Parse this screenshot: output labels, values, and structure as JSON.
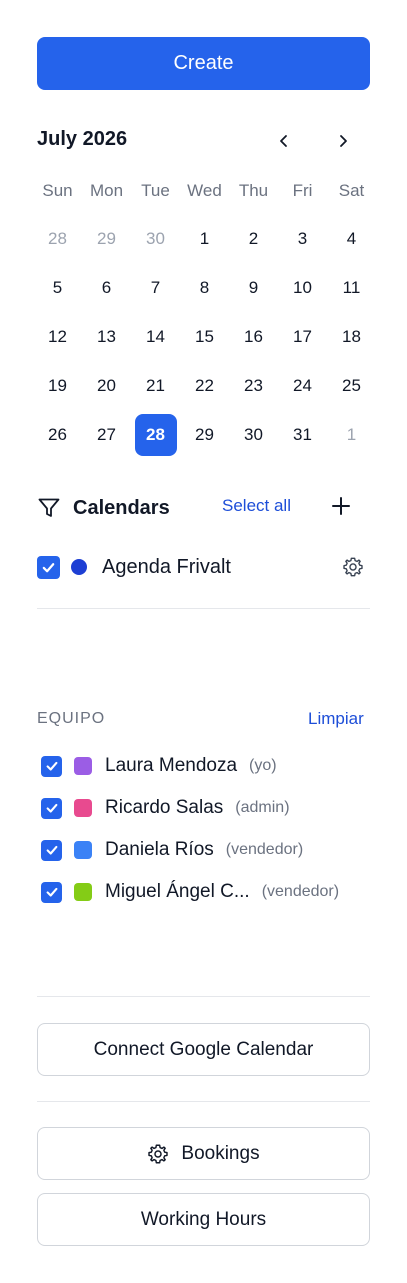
{
  "create": {
    "label": "Create"
  },
  "calendar": {
    "month_label": "July 2026",
    "weekdays": [
      "Sun",
      "Mon",
      "Tue",
      "Wed",
      "Thu",
      "Fri",
      "Sat"
    ],
    "weeks": [
      [
        {
          "d": "28",
          "m": true
        },
        {
          "d": "29",
          "m": true
        },
        {
          "d": "30",
          "m": true
        },
        {
          "d": "1"
        },
        {
          "d": "2"
        },
        {
          "d": "3"
        },
        {
          "d": "4"
        }
      ],
      [
        {
          "d": "5"
        },
        {
          "d": "6"
        },
        {
          "d": "7"
        },
        {
          "d": "8"
        },
        {
          "d": "9"
        },
        {
          "d": "10"
        },
        {
          "d": "11"
        }
      ],
      [
        {
          "d": "12"
        },
        {
          "d": "13"
        },
        {
          "d": "14"
        },
        {
          "d": "15"
        },
        {
          "d": "16"
        },
        {
          "d": "17"
        },
        {
          "d": "18"
        }
      ],
      [
        {
          "d": "19"
        },
        {
          "d": "20"
        },
        {
          "d": "21"
        },
        {
          "d": "22"
        },
        {
          "d": "23"
        },
        {
          "d": "24"
        },
        {
          "d": "25"
        }
      ],
      [
        {
          "d": "26"
        },
        {
          "d": "27"
        },
        {
          "d": "28",
          "s": true
        },
        {
          "d": "29"
        },
        {
          "d": "30"
        },
        {
          "d": "31"
        },
        {
          "d": "1",
          "m": true
        }
      ]
    ],
    "selected_day": "28"
  },
  "calendars": {
    "title": "Calendars",
    "select_all": "Select all",
    "items": [
      {
        "label": "Agenda Frivalt",
        "checked": true,
        "color": "#1d3fd4"
      }
    ]
  },
  "team": {
    "title": "EQUIPO",
    "clear_label": "Limpiar",
    "members": [
      {
        "name": "Laura Mendoza",
        "role": "(yo)",
        "color": "#9b5de5",
        "checked": true
      },
      {
        "name": "Ricardo Salas",
        "role": "(admin)",
        "color": "#e84a8f",
        "checked": true
      },
      {
        "name": "Daniela Ríos",
        "role": "(vendedor)",
        "color": "#3b82f6",
        "checked": true
      },
      {
        "name": "Miguel Ángel C...",
        "role": "(vendedor)",
        "color": "#84cc16",
        "checked": true
      }
    ]
  },
  "buttons": {
    "connect_google": "Connect Google Calendar",
    "bookings": "Bookings",
    "working_hours": "Working Hours"
  },
  "colors": {
    "accent": "#2563eb",
    "link": "#1d4ed8"
  }
}
